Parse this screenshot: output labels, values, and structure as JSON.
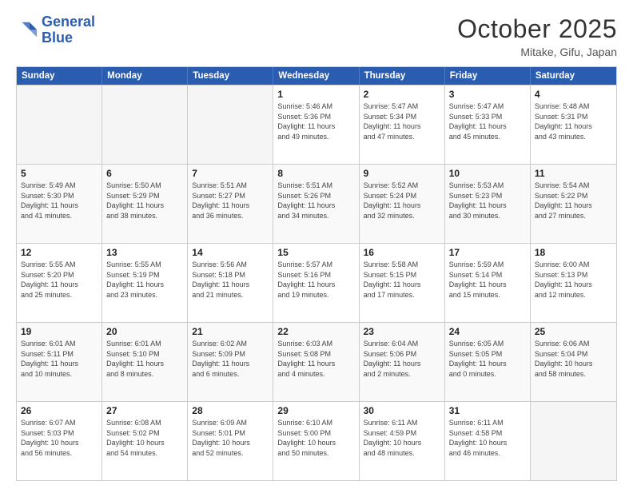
{
  "header": {
    "logo_line1": "General",
    "logo_line2": "Blue",
    "month": "October 2025",
    "location": "Mitake, Gifu, Japan"
  },
  "weekdays": [
    "Sunday",
    "Monday",
    "Tuesday",
    "Wednesday",
    "Thursday",
    "Friday",
    "Saturday"
  ],
  "rows": [
    [
      {
        "day": "",
        "text": ""
      },
      {
        "day": "",
        "text": ""
      },
      {
        "day": "",
        "text": ""
      },
      {
        "day": "1",
        "text": "Sunrise: 5:46 AM\nSunset: 5:36 PM\nDaylight: 11 hours\nand 49 minutes."
      },
      {
        "day": "2",
        "text": "Sunrise: 5:47 AM\nSunset: 5:34 PM\nDaylight: 11 hours\nand 47 minutes."
      },
      {
        "day": "3",
        "text": "Sunrise: 5:47 AM\nSunset: 5:33 PM\nDaylight: 11 hours\nand 45 minutes."
      },
      {
        "day": "4",
        "text": "Sunrise: 5:48 AM\nSunset: 5:31 PM\nDaylight: 11 hours\nand 43 minutes."
      }
    ],
    [
      {
        "day": "5",
        "text": "Sunrise: 5:49 AM\nSunset: 5:30 PM\nDaylight: 11 hours\nand 41 minutes."
      },
      {
        "day": "6",
        "text": "Sunrise: 5:50 AM\nSunset: 5:29 PM\nDaylight: 11 hours\nand 38 minutes."
      },
      {
        "day": "7",
        "text": "Sunrise: 5:51 AM\nSunset: 5:27 PM\nDaylight: 11 hours\nand 36 minutes."
      },
      {
        "day": "8",
        "text": "Sunrise: 5:51 AM\nSunset: 5:26 PM\nDaylight: 11 hours\nand 34 minutes."
      },
      {
        "day": "9",
        "text": "Sunrise: 5:52 AM\nSunset: 5:24 PM\nDaylight: 11 hours\nand 32 minutes."
      },
      {
        "day": "10",
        "text": "Sunrise: 5:53 AM\nSunset: 5:23 PM\nDaylight: 11 hours\nand 30 minutes."
      },
      {
        "day": "11",
        "text": "Sunrise: 5:54 AM\nSunset: 5:22 PM\nDaylight: 11 hours\nand 27 minutes."
      }
    ],
    [
      {
        "day": "12",
        "text": "Sunrise: 5:55 AM\nSunset: 5:20 PM\nDaylight: 11 hours\nand 25 minutes."
      },
      {
        "day": "13",
        "text": "Sunrise: 5:55 AM\nSunset: 5:19 PM\nDaylight: 11 hours\nand 23 minutes."
      },
      {
        "day": "14",
        "text": "Sunrise: 5:56 AM\nSunset: 5:18 PM\nDaylight: 11 hours\nand 21 minutes."
      },
      {
        "day": "15",
        "text": "Sunrise: 5:57 AM\nSunset: 5:16 PM\nDaylight: 11 hours\nand 19 minutes."
      },
      {
        "day": "16",
        "text": "Sunrise: 5:58 AM\nSunset: 5:15 PM\nDaylight: 11 hours\nand 17 minutes."
      },
      {
        "day": "17",
        "text": "Sunrise: 5:59 AM\nSunset: 5:14 PM\nDaylight: 11 hours\nand 15 minutes."
      },
      {
        "day": "18",
        "text": "Sunrise: 6:00 AM\nSunset: 5:13 PM\nDaylight: 11 hours\nand 12 minutes."
      }
    ],
    [
      {
        "day": "19",
        "text": "Sunrise: 6:01 AM\nSunset: 5:11 PM\nDaylight: 11 hours\nand 10 minutes."
      },
      {
        "day": "20",
        "text": "Sunrise: 6:01 AM\nSunset: 5:10 PM\nDaylight: 11 hours\nand 8 minutes."
      },
      {
        "day": "21",
        "text": "Sunrise: 6:02 AM\nSunset: 5:09 PM\nDaylight: 11 hours\nand 6 minutes."
      },
      {
        "day": "22",
        "text": "Sunrise: 6:03 AM\nSunset: 5:08 PM\nDaylight: 11 hours\nand 4 minutes."
      },
      {
        "day": "23",
        "text": "Sunrise: 6:04 AM\nSunset: 5:06 PM\nDaylight: 11 hours\nand 2 minutes."
      },
      {
        "day": "24",
        "text": "Sunrise: 6:05 AM\nSunset: 5:05 PM\nDaylight: 11 hours\nand 0 minutes."
      },
      {
        "day": "25",
        "text": "Sunrise: 6:06 AM\nSunset: 5:04 PM\nDaylight: 10 hours\nand 58 minutes."
      }
    ],
    [
      {
        "day": "26",
        "text": "Sunrise: 6:07 AM\nSunset: 5:03 PM\nDaylight: 10 hours\nand 56 minutes."
      },
      {
        "day": "27",
        "text": "Sunrise: 6:08 AM\nSunset: 5:02 PM\nDaylight: 10 hours\nand 54 minutes."
      },
      {
        "day": "28",
        "text": "Sunrise: 6:09 AM\nSunset: 5:01 PM\nDaylight: 10 hours\nand 52 minutes."
      },
      {
        "day": "29",
        "text": "Sunrise: 6:10 AM\nSunset: 5:00 PM\nDaylight: 10 hours\nand 50 minutes."
      },
      {
        "day": "30",
        "text": "Sunrise: 6:11 AM\nSunset: 4:59 PM\nDaylight: 10 hours\nand 48 minutes."
      },
      {
        "day": "31",
        "text": "Sunrise: 6:11 AM\nSunset: 4:58 PM\nDaylight: 10 hours\nand 46 minutes."
      },
      {
        "day": "",
        "text": ""
      }
    ]
  ]
}
